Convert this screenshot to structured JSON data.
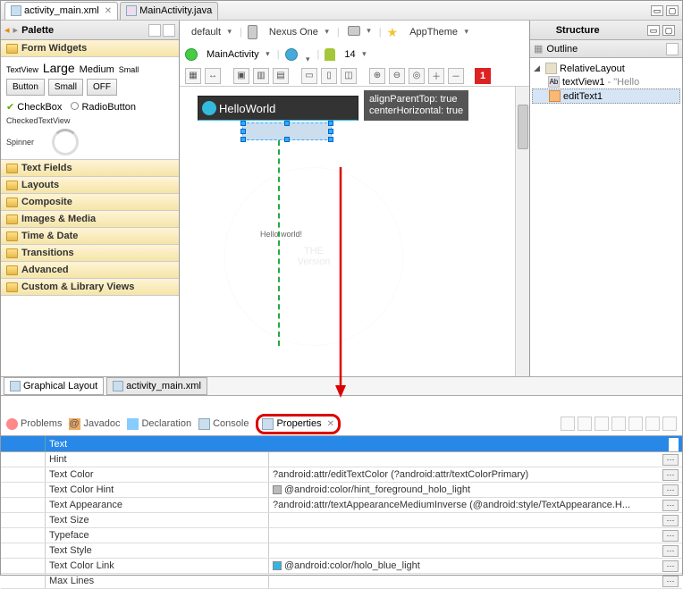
{
  "tabs": {
    "active": "activity_main.xml",
    "inactive": "MainActivity.java"
  },
  "palette": {
    "title": "Palette",
    "formWidgets": "Form Widgets",
    "tv": "TextView",
    "large": "Large",
    "medium": "Medium",
    "small": "Small",
    "btn": "Button",
    "btnSmall": "Small",
    "btnOff": "OFF",
    "checkbox": "CheckBox",
    "radio": "RadioButton",
    "ctv": "CheckedTextView",
    "spinner": "Spinner",
    "folders": [
      "Text Fields",
      "Layouts",
      "Composite",
      "Images & Media",
      "Time & Date",
      "Transitions",
      "Advanced",
      "Custom & Library Views"
    ]
  },
  "config": {
    "default": "default",
    "device": "Nexus One",
    "theme": "AppTheme",
    "activity": "MainActivity",
    "api": "14"
  },
  "toolbar_badge": "1",
  "phone": {
    "title": "HelloWorld",
    "hello": "Hello world!"
  },
  "tooltip": {
    "l1": "alignParentTop: true",
    "l2": "centerHorizontal: true"
  },
  "watermark": {
    "l1": "THE",
    "l2": "Version"
  },
  "structure": {
    "title": "Structure",
    "outline": "Outline",
    "root": "RelativeLayout",
    "tv": "textView1",
    "tvExtra": " - \"Hello",
    "et": "editText1"
  },
  "subtabs": {
    "gl": "Graphical Layout",
    "xml": "activity_main.xml"
  },
  "views": {
    "problems": "Problems",
    "javadoc": "Javadoc",
    "decl": "Declaration",
    "console": "Console",
    "props": "Properties"
  },
  "props": {
    "header": "Text",
    "rows": [
      {
        "k": "Hint",
        "v": ""
      },
      {
        "k": "Text Color",
        "v": "?android:attr/editTextColor (?android:attr/textColorPrimary)"
      },
      {
        "k": "Text Color Hint",
        "v": "@android:color/hint_foreground_holo_light",
        "sw": "#bbb"
      },
      {
        "k": "Text Appearance",
        "v": "?android:attr/textAppearanceMediumInverse (@android:style/TextAppearance.H..."
      },
      {
        "k": "Text Size",
        "v": ""
      },
      {
        "k": "Typeface",
        "v": ""
      },
      {
        "k": "Text Style",
        "v": ""
      },
      {
        "k": "Text Color Link",
        "v": "@android:color/holo_blue_light",
        "sw": "#33b5e5"
      },
      {
        "k": "Max Lines",
        "v": ""
      }
    ]
  }
}
